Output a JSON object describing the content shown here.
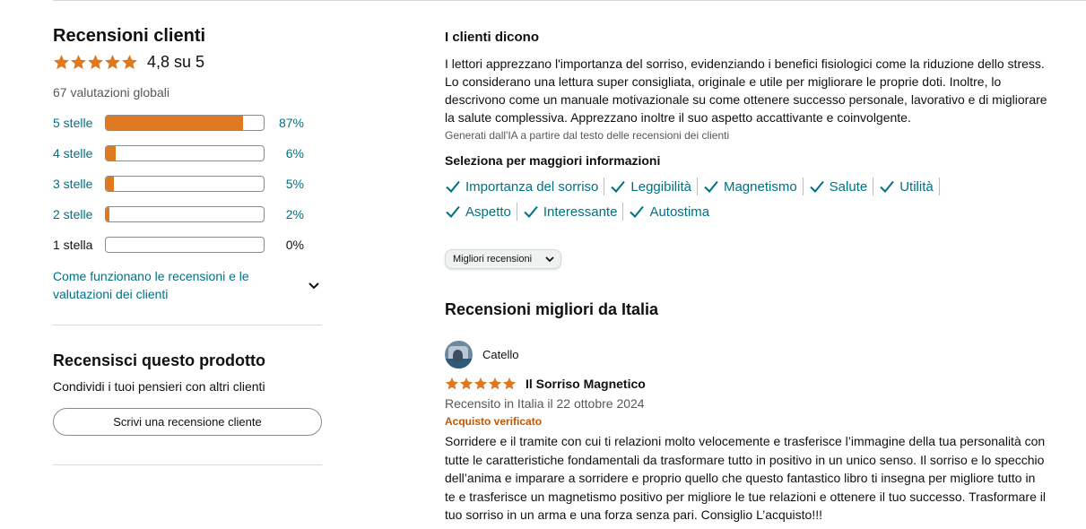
{
  "ratings": {
    "title": "Recensioni clienti",
    "stars": 4.8,
    "average_text": "4,8 su 5",
    "global_count": "67 valutazioni globali",
    "histogram": [
      {
        "label": "5 stelle",
        "percent": 87,
        "percent_text": "87%",
        "link": true
      },
      {
        "label": "4 stelle",
        "percent": 6,
        "percent_text": "6%",
        "link": true
      },
      {
        "label": "3 stelle",
        "percent": 5,
        "percent_text": "5%",
        "link": true
      },
      {
        "label": "2 stelle",
        "percent": 2,
        "percent_text": "2%",
        "link": true
      },
      {
        "label": "1 stella",
        "percent": 0,
        "percent_text": "0%",
        "link": false
      }
    ],
    "how_it_works": "Come funzionano le recensioni e le valutazioni dei clienti"
  },
  "review_product": {
    "title": "Recensisci questo prodotto",
    "subtitle": "Condividi i tuoi pensieri con altri clienti",
    "button": "Scrivi una recensione cliente"
  },
  "summary": {
    "title": "I clienti dicono",
    "text": "I lettori apprezzano l'importanza del sorriso, evidenziando i benefici fisiologici come la riduzione dello stress. Lo considerano una lettura super consigliata, originale e utile per migliorare le proprie doti. Inoltre, lo descrivono come un manuale motivazionale su come ottenere successo personale, lavorativo e di migliorare la salute complessiva. Apprezzano inoltre il suo aspetto accattivante e coinvolgente.",
    "ai_note": "Generati dall'IA a partire dal testo delle recensioni dei clienti",
    "select_title": "Seleziona per maggiori informazioni",
    "aspects": [
      "Importanza del sorriso",
      "Leggibilità",
      "Magnetismo",
      "Salute",
      "Utilità",
      "Aspetto",
      "Interessante",
      "Autostima"
    ]
  },
  "sort": {
    "selected": "Migliori recensioni"
  },
  "top_reviews": {
    "title": "Recensioni migliori da Italia",
    "review": {
      "author": "Catello",
      "stars": 5,
      "title": "Il Sorriso Magnetico",
      "date": "Recensito in Italia il 22 ottobre 2024",
      "verified": "Acquisto verificato",
      "body": "Sorridere e il tramite con cui ti relazioni molto velocemente e trasferisce l’immagine della tua personalità con tutte le caratteristiche fondamentali da trasformare tutto in positivo in un unico senso. Il sorriso e lo specchio dell’anima e imparare a sorridere e proprio quello che questo fantastico libro ti insegna per migliore tutto in te e trasferisce un magnetismo positivo per migliore le tue relazioni e ottenere il tuo successo. Trasformare il tuo sorriso in un arma e una forza senza pari. Consiglio L’acquisto!!!"
    }
  },
  "colors": {
    "star": "#de7921",
    "link": "#007185",
    "verified": "#c45500",
    "muted": "#565959"
  },
  "icons": {
    "star": "star-icon",
    "check": "check-icon",
    "chevron": "chevron-down-icon"
  }
}
